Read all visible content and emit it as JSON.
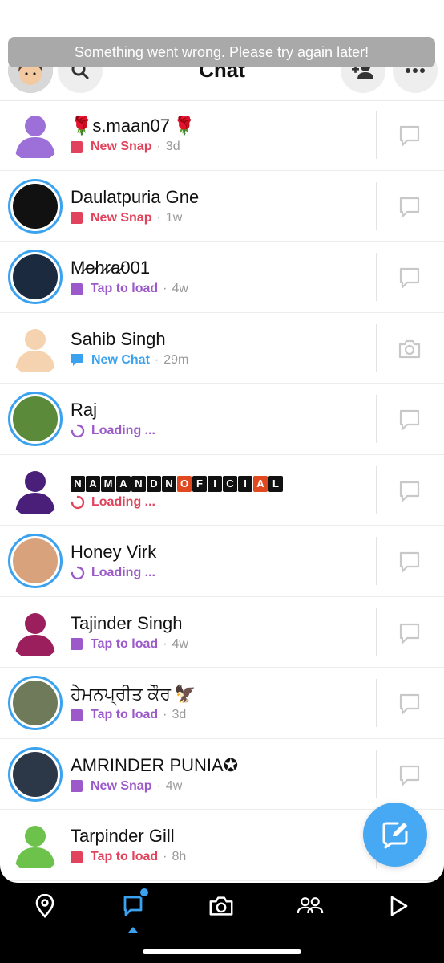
{
  "header": {
    "title": "Chat",
    "toast": "Something went wrong. Please try again later!"
  },
  "colors": {
    "snap_red": "#e0435b",
    "chat_blue": "#3aa2ef",
    "purple": "#9b59c9",
    "meta_gray": "#999999",
    "compose_blue": "#47a9f3"
  },
  "chats": [
    {
      "name_prefix": "🌹",
      "name": "s.maan07",
      "name_suffix": "🌹",
      "status": "New Snap",
      "time": "3d",
      "sep": "·",
      "status_color": "#e0435b",
      "icon": "square",
      "avatar_color": "#9d6fd8",
      "story": false,
      "reply_icon": "chat-bubble-icon"
    },
    {
      "name": "Daulatpuria Gne",
      "status": "New Snap",
      "time": "1w",
      "sep": "·",
      "status_color": "#e0435b",
      "icon": "square",
      "avatar_color": "#111111",
      "story": true,
      "reply_icon": "chat-bubble-icon"
    },
    {
      "name": "M̷e̷h̷r̷a̷001",
      "status": "Tap to load",
      "time": "4w",
      "sep": "·",
      "status_color": "#9b59c9",
      "icon": "square",
      "avatar_color": "#1c2a40",
      "story": true,
      "reply_icon": "chat-bubble-icon"
    },
    {
      "name": "Sahib Singh",
      "status": "New Chat",
      "time": "29m",
      "sep": "·",
      "status_color": "#3aa2ef",
      "icon": "bubble",
      "avatar_color": "#f5d3b0",
      "story": false,
      "reply_icon": "camera-icon"
    },
    {
      "name": "Raj",
      "status": "Loading ...",
      "time": "",
      "sep": "",
      "status_color": "#9b59c9",
      "icon": "spinner",
      "avatar_color": "#5a8a3a",
      "story": true,
      "reply_icon": "chat-bubble-icon"
    },
    {
      "name": "NAMANDNOFICIAL",
      "status": "Loading ...",
      "time": "",
      "sep": "",
      "status_color": "#e0435b",
      "icon": "spinner",
      "avatar_color": "#4a1f7a",
      "story": false,
      "reply_icon": "chat-bubble-icon"
    },
    {
      "name": "Honey Virk",
      "status": "Loading ...",
      "time": "",
      "sep": "",
      "status_color": "#9b59c9",
      "icon": "spinner",
      "avatar_color": "#d8a27c",
      "story": true,
      "reply_icon": "chat-bubble-icon"
    },
    {
      "name": "Tajinder Singh",
      "status": "Tap to load",
      "time": "4w",
      "sep": "·",
      "status_color": "#9b59c9",
      "icon": "square",
      "avatar_color": "#9a1f5c",
      "story": false,
      "reply_icon": "chat-bubble-icon"
    },
    {
      "name": "ਹੇਮਨਪ੍ਰੀਤ ਕੌਰ",
      "name_suffix": "🦅",
      "status": "Tap to load",
      "time": "3d",
      "sep": "·",
      "status_color": "#9b59c9",
      "icon": "square",
      "avatar_color": "#6f7a5a",
      "story": true,
      "reply_icon": "chat-bubble-icon"
    },
    {
      "name": "AMRINDER PUNIA✪",
      "status": "New Snap",
      "time": "4w",
      "sep": "·",
      "status_color": "#9b59c9",
      "icon": "square",
      "avatar_color": "#2c3848",
      "story": true,
      "reply_icon": "chat-bubble-icon"
    },
    {
      "name": "Tarpinder Gill",
      "status": "Tap to load",
      "time": "8h",
      "sep": "·",
      "status_color": "#e0435b",
      "icon": "square",
      "avatar_color": "#6cc24a",
      "story": false,
      "reply_icon": "chat-bubble-icon"
    }
  ],
  "nav": {
    "items": [
      "map-pin-icon",
      "chat-icon",
      "camera-icon",
      "friends-icon",
      "play-icon"
    ],
    "active": "chat-icon"
  }
}
